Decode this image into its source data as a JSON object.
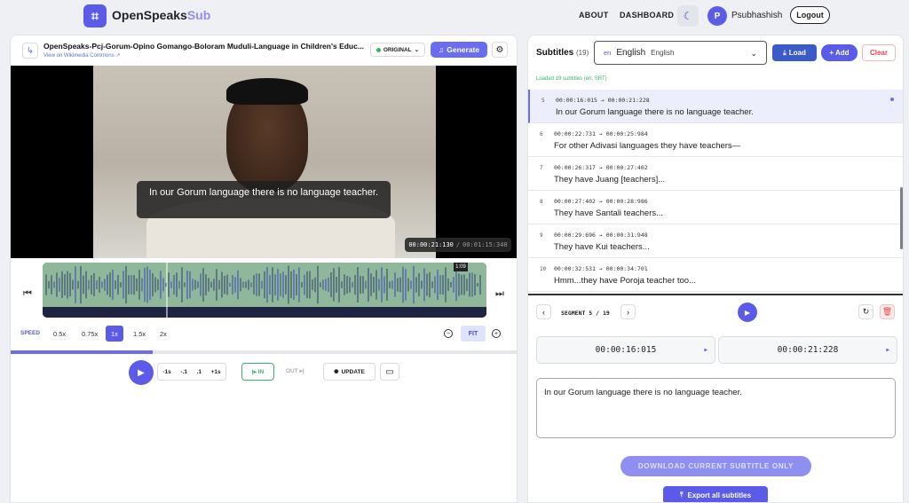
{
  "header": {
    "brand_main": "OpenSpeaks",
    "brand_sub": "Sub",
    "nav_about": "ABOUT",
    "nav_dashboard": "DASHBOARD",
    "avatar_initial": "P",
    "username": "Psubhashish",
    "logout": "Logout"
  },
  "video": {
    "title": "OpenSpeaks-Pcj-Gorum-Opino Gomango-Boloram Muduli-Language in Children's Educ...",
    "source": "View on Wikimedia Commons",
    "original_label": "ORIGINAL",
    "generate_label": "Generate",
    "caption": "In our Gorum language there is no language teacher.",
    "current_time": "00:00:21:130",
    "separator": "/",
    "duration": "00:01:15:340",
    "cursor_label": "1:09",
    "progress": 0.28
  },
  "speed": {
    "label": "SPEED",
    "options": [
      "0.5x",
      "0.75x",
      "1x",
      "1.5x",
      "2x"
    ],
    "selected": "1x",
    "fit": "FIT"
  },
  "controls": {
    "step_back_1s": "-1s",
    "step_back_01": "-.1",
    "step_fwd_01": ".1",
    "step_fwd_1s": "+1s",
    "in_label": "IN",
    "out_label": "OUT",
    "update_label": "UPDATE"
  },
  "subtitles": {
    "title": "Subtitles",
    "count": "(19)",
    "lang_code": "en",
    "lang_name": "English",
    "lang_native": "English",
    "load": "Load",
    "add": "+ Add",
    "clear": "Clear",
    "loaded_msg": "Loaded 19 subtitles (en, SRT)",
    "items": [
      {
        "num": "5",
        "time": "00:00:16:015 → 00:00:21:228",
        "text": "In our Gorum language there is no language teacher."
      },
      {
        "num": "6",
        "time": "00:00:22:731 → 00:00:25:984",
        "text": "For other Adivasi languages they have teachers—"
      },
      {
        "num": "7",
        "time": "00:00:26:317 → 00:00:27:402",
        "text": "They have Juang [teachers]..."
      },
      {
        "num": "8",
        "time": "00:00:27:402 → 00:00:28:986",
        "text": "They have Santali teachers..."
      },
      {
        "num": "9",
        "time": "00:00:29:696 → 00:00:31:948",
        "text": "They have Kui teachers..."
      },
      {
        "num": "10",
        "time": "00:00:32:531 → 00:00:34:701",
        "text": "Hmm...they have Poroja teacher too..."
      }
    ]
  },
  "segment": {
    "label": "SEGMENT 5 / 19",
    "start": "00:00:16:015",
    "end": "00:00:21:228",
    "text": "In our Gorum language there is no language teacher.",
    "download": "DOWNLOAD CURRENT SUBTITLE ONLY",
    "export": "Export all subtitles"
  },
  "colors": {
    "accent": "#5a5be8",
    "wave_green": "#8fb89a",
    "success": "#3cb36c",
    "danger": "#e44455"
  }
}
